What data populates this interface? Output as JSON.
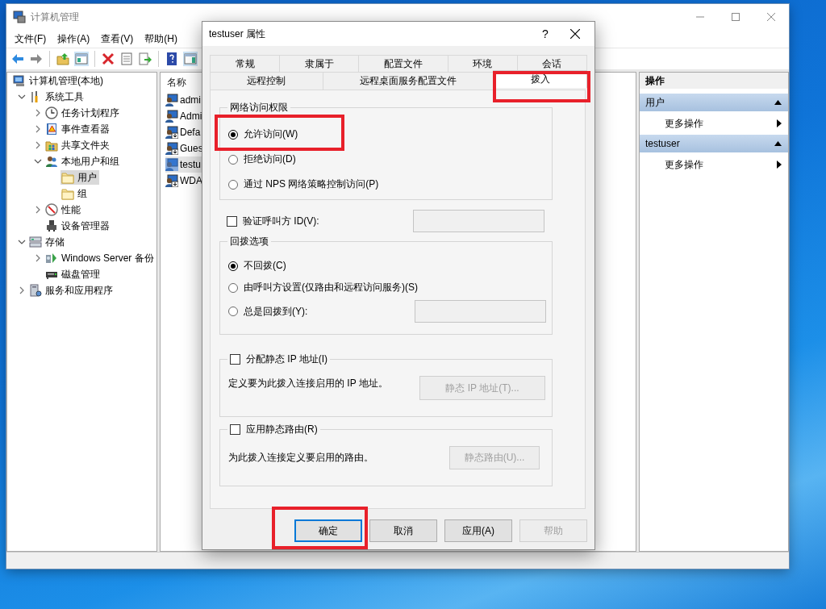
{
  "window": {
    "title": "计算机管理",
    "menu": [
      "文件(F)",
      "操作(A)",
      "查看(V)",
      "帮助(H)"
    ]
  },
  "toolbar": [
    {
      "kind": "back",
      "pressed": false
    },
    {
      "kind": "forward",
      "pressed": false
    },
    {
      "kind": "separator"
    },
    {
      "kind": "up",
      "pressed": false
    },
    {
      "kind": "tree",
      "pressed": true
    },
    {
      "kind": "separator"
    },
    {
      "kind": "delete",
      "pressed": false
    },
    {
      "kind": "properties",
      "pressed": false
    },
    {
      "kind": "export",
      "pressed": false
    },
    {
      "kind": "separator"
    },
    {
      "kind": "help",
      "pressed": false
    },
    {
      "kind": "actionpane",
      "pressed": true
    }
  ],
  "tree": [
    {
      "label": "计算机管理(本地)",
      "kind": "computer",
      "selected": false,
      "children": [
        {
          "label": "系统工具",
          "kind": "tools",
          "expanded": true,
          "selected": false,
          "children": [
            {
              "label": "任务计划程序",
              "kind": "clock",
              "expanded": false,
              "selected": false
            },
            {
              "label": "事件查看器",
              "kind": "event",
              "expanded": false,
              "selected": false
            },
            {
              "label": "共享文件夹",
              "kind": "share",
              "expanded": false,
              "selected": false
            },
            {
              "label": "本地用户和组",
              "kind": "users",
              "expanded": true,
              "selected": false,
              "children": [
                {
                  "label": "用户",
                  "kind": "folder",
                  "selected": true
                },
                {
                  "label": "组",
                  "kind": "folder",
                  "selected": false
                }
              ]
            },
            {
              "label": "性能",
              "kind": "perf",
              "expanded": false,
              "selected": false
            },
            {
              "label": "设备管理器",
              "kind": "device",
              "selected": false
            }
          ]
        },
        {
          "label": "存储",
          "kind": "storage",
          "expanded": true,
          "selected": false,
          "children": [
            {
              "label": "Windows Server 备份",
              "kind": "backup",
              "expanded": false,
              "selected": false
            },
            {
              "label": "磁盘管理",
              "kind": "disk",
              "selected": false
            }
          ]
        },
        {
          "label": "服务和应用程序",
          "kind": "services",
          "expanded": false,
          "selected": false
        }
      ]
    }
  ],
  "list": {
    "columns": [
      "名称"
    ],
    "rows": [
      {
        "name": "admi",
        "kind": "user",
        "selected": false
      },
      {
        "name": "Admi",
        "kind": "user",
        "selected": false
      },
      {
        "name": "Defa",
        "kind": "disabled-user",
        "selected": false
      },
      {
        "name": "Gues",
        "kind": "disabled-user",
        "selected": false
      },
      {
        "name": "testu",
        "kind": "user",
        "selected": true
      },
      {
        "name": "WDA",
        "kind": "disabled-user",
        "selected": false
      }
    ]
  },
  "actions": {
    "title": "操作",
    "sections": [
      {
        "title": "用户",
        "expanded": true,
        "items": [
          {
            "label": "更多操作"
          }
        ]
      },
      {
        "title": "testuser",
        "expanded": true,
        "items": [
          {
            "label": "更多操作"
          }
        ]
      }
    ]
  },
  "dialog": {
    "title": "testuser 属性",
    "help": "?",
    "tab_rows": [
      [
        {
          "label": "常规",
          "selected": false,
          "highlighted": false
        },
        {
          "label": "隶属于",
          "selected": false,
          "highlighted": false
        },
        {
          "label": "配置文件",
          "selected": false,
          "highlighted": false
        },
        {
          "label": "环境",
          "selected": false,
          "highlighted": false
        },
        {
          "label": "会话",
          "selected": false,
          "highlighted": false
        }
      ],
      [
        {
          "label": "远程控制",
          "selected": false,
          "highlighted": false
        },
        {
          "label": "远程桌面服务配置文件",
          "selected": false,
          "highlighted": false
        },
        {
          "label": "拨入",
          "selected": true,
          "highlighted": true
        }
      ]
    ],
    "network_access": {
      "title": "网络访问权限",
      "options": [
        {
          "label": "允许访问(W)",
          "kind": "plain",
          "selected": true,
          "highlighted": true
        },
        {
          "label": "拒绝访问(D)",
          "kind": "plain",
          "selected": false,
          "highlighted": false
        },
        {
          "label": "通过 NPS 网络策略控制访问(P)",
          "kind": "plain",
          "selected": false,
          "highlighted": false
        }
      ]
    },
    "verify_caller": {
      "label": "验证呼叫方 ID(V):",
      "checked": false,
      "field_disabled": true
    },
    "callback": {
      "title": "回拨选项",
      "options": [
        {
          "label": "不回拨(C)",
          "kind": "plain",
          "selected": true,
          "highlighted": false
        },
        {
          "label": "由呼叫方设置(仅路由和远程访问服务)(S)",
          "kind": "plain",
          "selected": false,
          "highlighted": false
        },
        {
          "label": "总是回拨到(Y):",
          "kind": "field",
          "selected": false,
          "highlighted": false
        }
      ]
    },
    "static_groups": [
      {
        "label": "分配静态 IP 地址(I)",
        "checked": false,
        "description": "定义要为此拨入连接启用的 IP 地址。",
        "button": "静态 IP 地址(T)...",
        "disabled": true
      },
      {
        "label": "应用静态路由(R)",
        "checked": false,
        "description": "为此拨入连接定义要启用的路由。",
        "button": "静态路由(U)...",
        "disabled": true
      }
    ],
    "buttons": [
      {
        "label": "确定",
        "default": true,
        "disabled": false,
        "highlighted": true
      },
      {
        "label": "取消",
        "default": false,
        "disabled": false,
        "highlighted": false
      },
      {
        "label": "应用(A)",
        "default": false,
        "disabled": false,
        "highlighted": false
      },
      {
        "label": "帮助",
        "default": false,
        "disabled": true,
        "highlighted": false
      }
    ]
  }
}
